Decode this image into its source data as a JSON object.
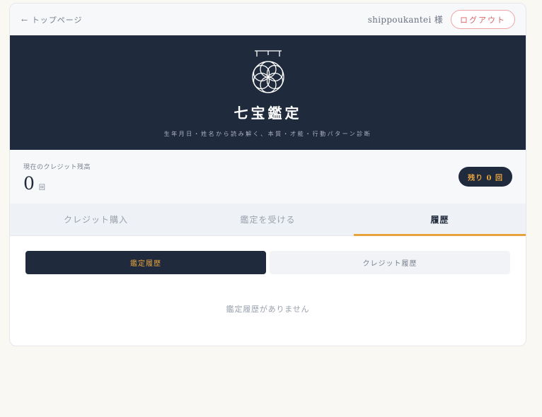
{
  "header": {
    "back_label": "← トップページ",
    "user_name": "shippoukantei 様",
    "logout_label": "ログアウト"
  },
  "hero": {
    "logo_icon": "seven-treasures-flower-icon",
    "title": "七宝鑑定",
    "subtitle": "生年月日・姓名から読み解く、本質・才能・行動パターン診断"
  },
  "credit": {
    "label": "現在のクレジット残高",
    "value": "0",
    "unit": "回",
    "remaining_badge": "残り 0 回"
  },
  "tabs": [
    {
      "label": "クレジット購入",
      "active": false
    },
    {
      "label": "鑑定を受ける",
      "active": false
    },
    {
      "label": "履歴",
      "active": true
    }
  ],
  "history": {
    "subtabs": [
      {
        "label": "鑑定履歴",
        "active": true
      },
      {
        "label": "クレジット履歴",
        "active": false
      }
    ],
    "empty_message": "鑑定履歴がありません"
  },
  "colors": {
    "navy": "#1f2a3d",
    "accent_gold": "#e8a33d",
    "logout_red": "#d96666",
    "page_bg": "#faf8f3"
  }
}
